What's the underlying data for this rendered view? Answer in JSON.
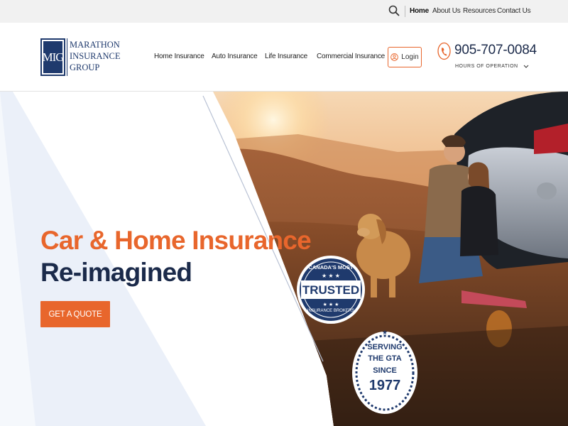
{
  "topbar": {
    "search_icon": "search-icon",
    "links": [
      {
        "label": "Home",
        "active": true
      },
      {
        "label": "About Us",
        "active": false
      },
      {
        "label": "Resources",
        "active": false
      },
      {
        "label": "Contact Us",
        "active": false
      }
    ]
  },
  "logo": {
    "monogram": "MIG",
    "text": "MARATHON\nINSURANCE\nGROUP"
  },
  "nav": {
    "items": [
      "Home Insurance",
      "Auto Insurance",
      "Life Insurance",
      "Commercial Insurance"
    ]
  },
  "login": {
    "label": "Login",
    "icon": "user-icon"
  },
  "contact": {
    "phone": "905-707-0084",
    "hours_label": "HOURS OF OPERATION",
    "phone_icon": "phone-icon"
  },
  "hero": {
    "headline_line1": "Car & Home Insurance",
    "headline_line2": "Re-imagined",
    "cta_label": "GET A QUOTE"
  },
  "badges": {
    "trusted": {
      "top_text": "CANADA'S MOST",
      "main_text": "TRUSTED",
      "bottom_text": "INSURANCE BROKERS"
    },
    "gta": {
      "line1": "SERVING",
      "line2": "THE GTA",
      "line3": "SINCE",
      "line4": "1977"
    }
  },
  "colors": {
    "accent": "#e8662c",
    "navy": "#1b2a4a",
    "logo_blue": "#1f3a6d"
  }
}
